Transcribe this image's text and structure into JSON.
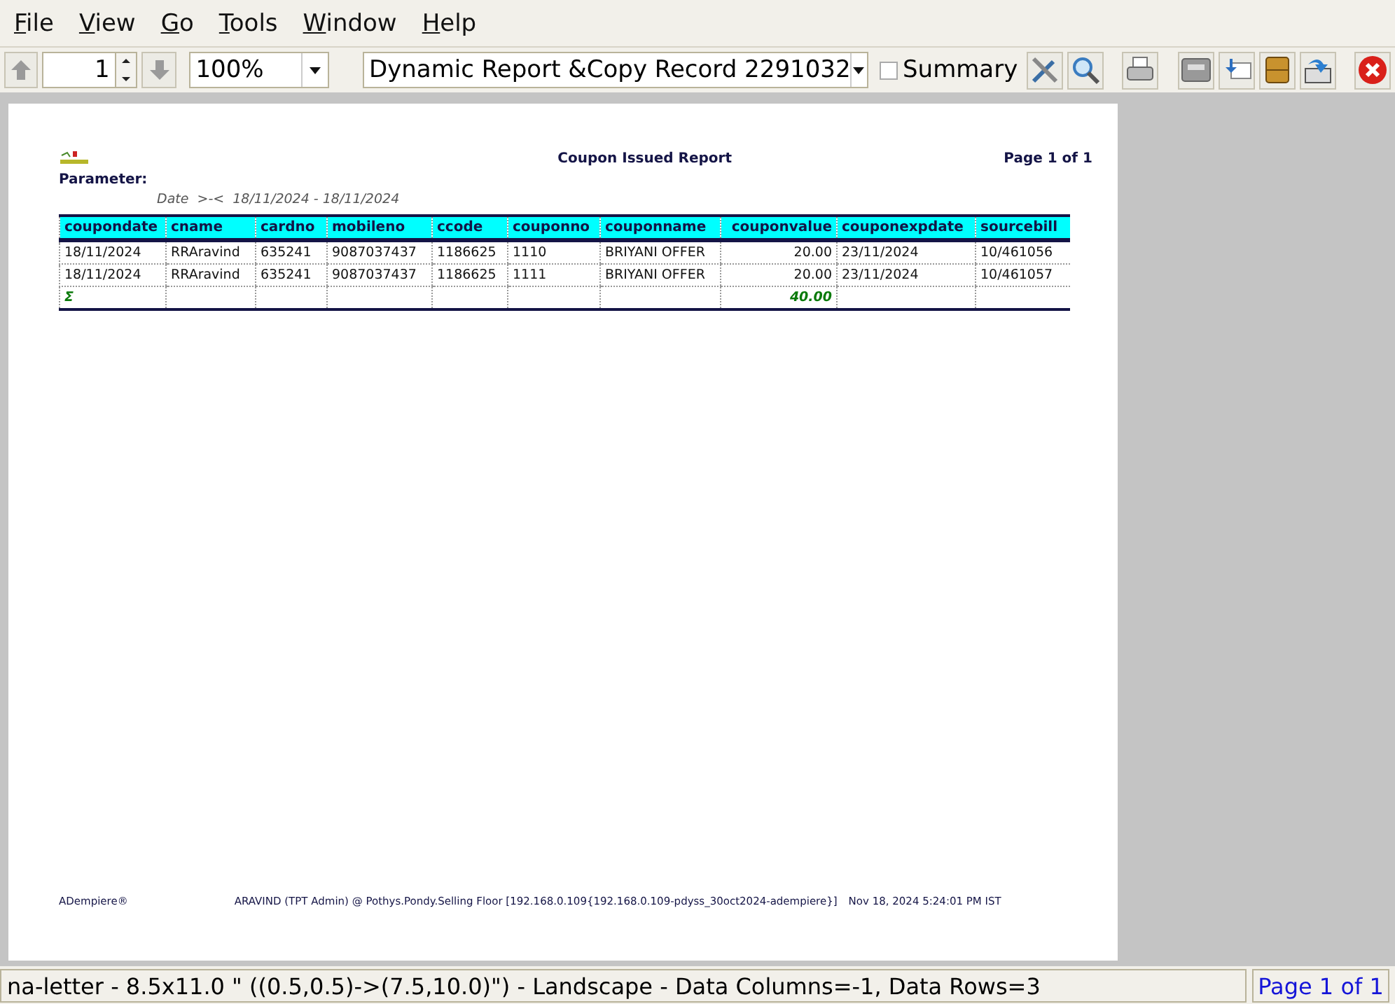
{
  "menu": [
    "File",
    "View",
    "Go",
    "Tools",
    "Window",
    "Help"
  ],
  "toolbar": {
    "page_number": "1",
    "zoom": "100%",
    "report": "Dynamic Report &Copy Record 2291032",
    "summary": {
      "label": "Summary",
      "checked": false
    }
  },
  "report": {
    "title": "Coupon Issued Report",
    "page": "Page 1 of 1",
    "parameter_label": "Parameter:",
    "parameter": "Date  >-<  18/11/2024 - 18/11/2024",
    "columns": [
      {
        "label": "coupondate",
        "numeric": false
      },
      {
        "label": "cname",
        "numeric": false
      },
      {
        "label": "cardno",
        "numeric": false
      },
      {
        "label": "mobileno",
        "numeric": false
      },
      {
        "label": "ccode",
        "numeric": false
      },
      {
        "label": "couponno",
        "numeric": false
      },
      {
        "label": "couponname",
        "numeric": false
      },
      {
        "label": "couponvalue",
        "numeric": true,
        "total": "40.00"
      },
      {
        "label": "couponexpdate",
        "numeric": false
      },
      {
        "label": "sourcebill",
        "numeric": false
      }
    ],
    "rows": [
      [
        "18/11/2024",
        "RRAravind",
        "635241",
        "9087037437",
        "1186625",
        "1110",
        "BRIYANI OFFER",
        "20.00",
        "23/11/2024",
        "10/461056"
      ],
      [
        "18/11/2024",
        "RRAravind",
        "635241",
        "9087037437",
        "1186625",
        "1111",
        "BRIYANI OFFER",
        "20.00",
        "23/11/2024",
        "10/461057"
      ]
    ],
    "total_symbol": "Σ",
    "footer": {
      "left": "ADempiere®",
      "center": "ARAVIND (TPT Admin) @ Pothys.Pondy.Selling Floor [192.168.0.109{192.168.0.109-pdyss_30oct2024-adempiere}]",
      "right": "Nov 18, 2024 5:24:01 PM IST"
    }
  },
  "status_bar": {
    "info": "na-letter - 8.5x11.0 \" ((0.5,0.5)->(7.5,10.0)\") - Landscape - Data Columns=-1, Data Rows=3",
    "page": "Page 1 of 1"
  }
}
